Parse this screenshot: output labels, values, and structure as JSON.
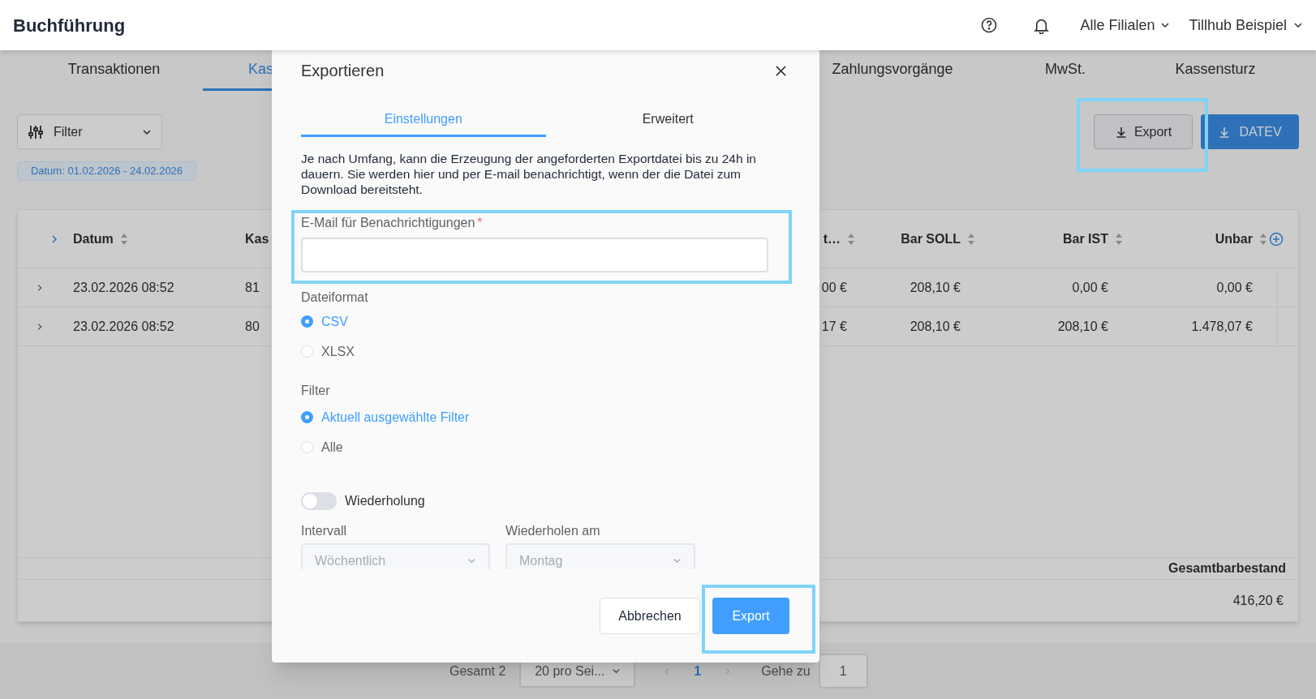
{
  "header": {
    "title": "Buchführung",
    "branch_select": "Alle Filialen",
    "account_select": "Tillhub Beispiel"
  },
  "tabs": [
    {
      "label": "Transaktionen",
      "selected": false
    },
    {
      "label": "Kas",
      "selected": true
    },
    {
      "label": "Zahlungsvorgänge",
      "selected": false
    },
    {
      "label": "MwSt.",
      "selected": false
    },
    {
      "label": "Kassensturz",
      "selected": false
    }
  ],
  "toolbar": {
    "filter_button": "Filter",
    "active_filter": "Datum: 01.02.2026 - 24.02.2026",
    "export_button": "Export",
    "datev_button": "DATEV"
  },
  "table": {
    "columns": [
      {
        "label": "Datum"
      },
      {
        "label": "Kas"
      },
      {
        "label": "t…"
      },
      {
        "label": "Bar SOLL"
      },
      {
        "label": "Bar IST"
      },
      {
        "label": "Unbar"
      }
    ],
    "rows": [
      {
        "cells": [
          "23.02.2026 08:52",
          "81",
          "00 €",
          "208,10 €",
          "0,00 €",
          "0,00 €"
        ]
      },
      {
        "cells": [
          "23.02.2026 08:52",
          "80",
          "17 €",
          "208,10 €",
          "208,10 €",
          "1.478,07 €"
        ]
      }
    ],
    "footer_label": "Gesamtbarbestand",
    "footer_value": "416,20 €"
  },
  "pagination": {
    "total": "Gesamt 2",
    "page_size": "20 pro Sei...",
    "pages": [
      {
        "label": "1",
        "selected": true
      }
    ],
    "goto_label": "Gehe zu",
    "goto_value": "1"
  },
  "dialog": {
    "title": "Exportieren",
    "tabs": [
      {
        "label": "Einstellungen",
        "selected": true
      },
      {
        "label": "Erweitert",
        "selected": false
      }
    ],
    "description": "Je nach Umfang, kann die Erzeugung der angeforderten Exportdatei bis zu 24h in dauern. Sie werden hier und per E-mail benachrichtigt, wenn der die Datei zum Download bereitsteht.",
    "email": {
      "label": "E-Mail für Benachrichtigungen",
      "required_mark": "*"
    },
    "file_format": {
      "label": "Dateiformat",
      "options": [
        {
          "label": "CSV",
          "selected": true
        },
        {
          "label": "XLSX",
          "selected": false
        }
      ]
    },
    "filter": {
      "label": "Filter",
      "options": [
        {
          "label": "Aktuell ausgewählte Filter",
          "selected": true
        },
        {
          "label": "Alle",
          "selected": false
        }
      ]
    },
    "repeat": {
      "label": "Wiederholung",
      "on": false
    },
    "interval": {
      "label": "Intervall",
      "value": "Wöchentlich",
      "disabled": true
    },
    "repeat_on": {
      "label": "Wiederholen am",
      "value": "Montag",
      "disabled": true
    },
    "buttons": [
      {
        "label": "Abbrechen",
        "kind": "secondary"
      },
      {
        "label": "Export",
        "kind": "primary"
      }
    ]
  }
}
